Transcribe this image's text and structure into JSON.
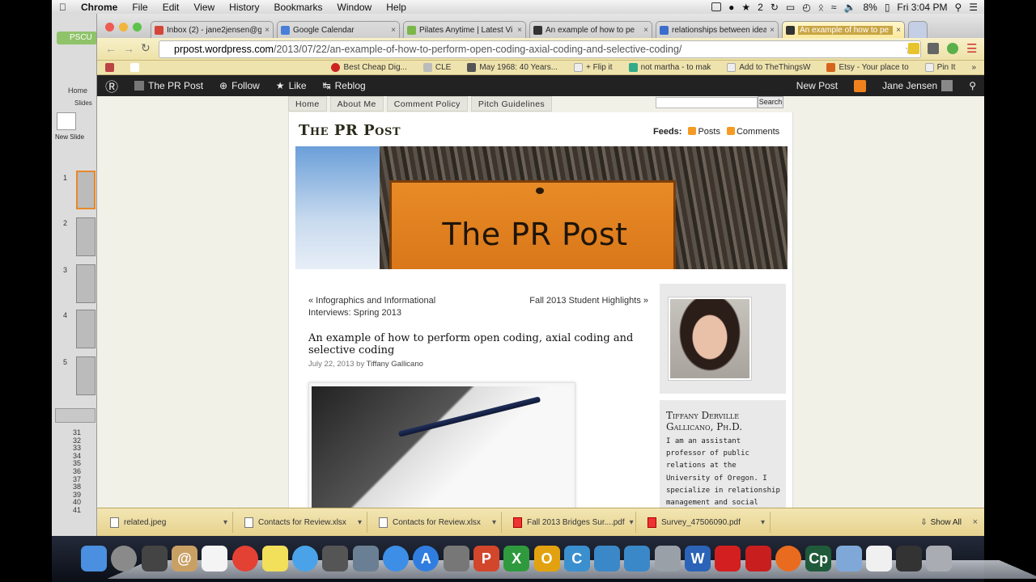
{
  "menubar": {
    "app": "Chrome",
    "items": [
      "File",
      "Edit",
      "View",
      "History",
      "Bookmarks",
      "Window",
      "Help"
    ],
    "battery": "8%",
    "clock": "Fri 3:04 PM",
    "notification_count": "2"
  },
  "ppt": {
    "tab_label": "PSCU",
    "home_label": "Home",
    "slides_label": "Slides",
    "new_slide_label": "New Slide",
    "slide_numbers": [
      "1",
      "2",
      "3",
      "4",
      "5"
    ],
    "row_numbers": [
      "31",
      "32",
      "33",
      "34",
      "35",
      "36",
      "37",
      "38",
      "39",
      "40",
      "41"
    ]
  },
  "tabs": [
    {
      "label": "Inbox (2) - jane2jensen@g",
      "color": "#d44638"
    },
    {
      "label": "Google Calendar",
      "color": "#4a7fd9"
    },
    {
      "label": "Pilates Anytime | Latest Vi",
      "color": "#7ab648"
    },
    {
      "label": "An example of how to pe",
      "color": "#333333"
    },
    {
      "label": "relationships between idea",
      "color": "#3b6ecc"
    },
    {
      "label": "An example of how to pe",
      "color": "#333333"
    }
  ],
  "omnibox": {
    "host": "prpost.wordpress.com",
    "path": "/2013/07/22/an-example-of-how-to-perform-open-coding-axial-coding-and-selective-coding/"
  },
  "bookmarks": [
    {
      "label": "Best Cheap Dig...",
      "color": "#cc2222"
    },
    {
      "label": "CLE",
      "color": "#bbbbbb"
    },
    {
      "label": "May 1968: 40 Years...",
      "color": "#555555"
    },
    {
      "label": "+ Flip it",
      "color": "#eeeeee"
    },
    {
      "label": "not martha - to mak",
      "color": "#33aa88"
    },
    {
      "label": "Add to TheThingsW",
      "color": "#eeeeee"
    },
    {
      "label": "Etsy - Your place to",
      "color": "#d5641c"
    },
    {
      "label": "Pin It",
      "color": "#eeeeee"
    }
  ],
  "wpbar": {
    "site": "The PR Post",
    "follow": "Follow",
    "like": "Like",
    "reblog": "Reblog",
    "new_post": "New Post",
    "user": "Jane Jensen"
  },
  "page": {
    "nav": [
      "Home",
      "About Me",
      "Comment Policy",
      "Pitch Guidelines"
    ],
    "search_button": "Search",
    "blog_title": "The PR Post",
    "feeds_label": "Feeds:",
    "feeds_posts": "Posts",
    "feeds_comments": "Comments",
    "header_sign": "The PR Post",
    "prev_link": "« Infographics and Informational Interviews: Spring 2013",
    "next_link": "Fall 2013 Student Highlights »",
    "post_title": "An example of how to perform open coding, axial coding and selective coding",
    "post_date": "July 22, 2013",
    "post_by": "by",
    "post_author": "Tiffany Gallicano",
    "bio_name": "Tiffany Derville Gallicano, Ph.D.",
    "bio_text": "I am an assistant professor of public relations at the University of Oregon. I specialize in relationship management and social media. I teach classes such as"
  },
  "downloads": [
    {
      "label": "related.jpeg",
      "type": "file"
    },
    {
      "label": "Contacts for Review.xlsx",
      "type": "file"
    },
    {
      "label": "Contacts for Review.xlsx",
      "type": "file"
    },
    {
      "label": "Fall 2013 Bridges Sur....pdf",
      "type": "pdf"
    },
    {
      "label": "Survey_47506090.pdf",
      "type": "pdf"
    }
  ],
  "downloads_show_all": "Show All",
  "dock": [
    {
      "name": "finder",
      "color": "#4a8fe0",
      "glyph": ""
    },
    {
      "name": "launchpad",
      "color": "#8a8a8a",
      "glyph": ""
    },
    {
      "name": "photobooth",
      "color": "#444444",
      "glyph": ""
    },
    {
      "name": "contacts",
      "color": "#c9a064",
      "glyph": "@"
    },
    {
      "name": "reminders",
      "color": "#f4f4f4",
      "glyph": ""
    },
    {
      "name": "chrome",
      "color": "#e34133",
      "glyph": ""
    },
    {
      "name": "stickies",
      "color": "#f2df5a",
      "glyph": ""
    },
    {
      "name": "messages",
      "color": "#4aa3e8",
      "glyph": ""
    },
    {
      "name": "facetime",
      "color": "#555555",
      "glyph": ""
    },
    {
      "name": "iphoto",
      "color": "#6a7f93",
      "glyph": ""
    },
    {
      "name": "itunes",
      "color": "#3c8ee6",
      "glyph": ""
    },
    {
      "name": "appstore",
      "color": "#2f7de0",
      "glyph": "A"
    },
    {
      "name": "preferences",
      "color": "#777777",
      "glyph": ""
    },
    {
      "name": "powerpoint",
      "color": "#d2462c",
      "glyph": "P"
    },
    {
      "name": "excel",
      "color": "#2f9a3d",
      "glyph": "X"
    },
    {
      "name": "outlook",
      "color": "#e2a20f",
      "glyph": "O"
    },
    {
      "name": "captivate-c",
      "color": "#3a8fcf",
      "glyph": "C"
    },
    {
      "name": "lync",
      "color": "#3a88c8",
      "glyph": ""
    },
    {
      "name": "network",
      "color": "#3a88c8",
      "glyph": ""
    },
    {
      "name": "tools",
      "color": "#9aa0a8",
      "glyph": ""
    },
    {
      "name": "word",
      "color": "#2b63b8",
      "glyph": "W"
    },
    {
      "name": "acrobat",
      "color": "#d31f1f",
      "glyph": ""
    },
    {
      "name": "reader",
      "color": "#c81e1e",
      "glyph": ""
    },
    {
      "name": "firefox",
      "color": "#e96b1f",
      "glyph": ""
    },
    {
      "name": "captivate",
      "color": "#1f5b3a",
      "glyph": "Cp"
    },
    {
      "name": "folder",
      "color": "#7fa8d8",
      "glyph": ""
    },
    {
      "name": "document",
      "color": "#f0f0f0",
      "glyph": ""
    },
    {
      "name": "stack",
      "color": "#333333",
      "glyph": ""
    },
    {
      "name": "trash",
      "color": "#a9adb3",
      "glyph": ""
    }
  ]
}
